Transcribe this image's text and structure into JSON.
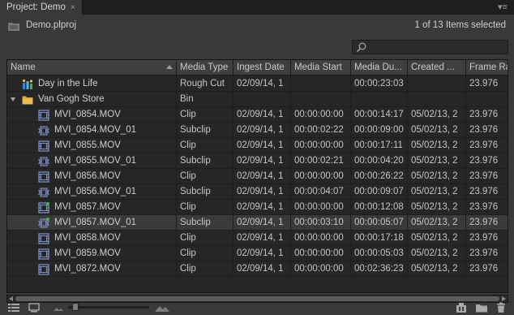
{
  "panel": {
    "tab_label": "Project: Demo",
    "close_glyph": "×",
    "menu_glyph": "▾≡"
  },
  "project": {
    "file_name": "Demo.plproj",
    "selection_status": "1 of 13 Items selected"
  },
  "search": {
    "placeholder": ""
  },
  "columns": [
    "Name",
    "Media Type",
    "Ingest Date",
    "Media Start",
    "Media Du...",
    "Created ...",
    "Frame Ra"
  ],
  "rows": [
    {
      "name": "Day in the Life",
      "icon": "rough-cut-icon",
      "indent": 1,
      "media_type": "Rough Cut",
      "ingest_date": "02/09/14, 1",
      "media_start": "",
      "media_duration": "00:00:23:03",
      "created": "",
      "frame_rate": "23.976"
    },
    {
      "name": "Van Gogh Store",
      "icon": "folder-icon",
      "indent": 0,
      "expanded": true,
      "media_type": "Bin",
      "ingest_date": "",
      "media_start": "",
      "media_duration": "",
      "created": "",
      "frame_rate": ""
    },
    {
      "name": "MVI_0854.MOV",
      "icon": "clip-icon",
      "indent": 2,
      "media_type": "Clip",
      "ingest_date": "02/09/14, 1",
      "media_start": "00:00:00:00",
      "media_duration": "00:00:14:17",
      "created": "05/02/13, 2",
      "frame_rate": "23.976"
    },
    {
      "name": "MVI_0854.MOV_01",
      "icon": "subclip-icon",
      "indent": 2,
      "media_type": "Subclip",
      "ingest_date": "02/09/14, 1",
      "media_start": "00:00:02:22",
      "media_duration": "00:00:09:00",
      "created": "05/02/13, 2",
      "frame_rate": "23.976"
    },
    {
      "name": "MVI_0855.MOV",
      "icon": "clip-icon",
      "indent": 2,
      "media_type": "Clip",
      "ingest_date": "02/09/14, 1",
      "media_start": "00:00:00:00",
      "media_duration": "00:00:17:11",
      "created": "05/02/13, 2",
      "frame_rate": "23.976"
    },
    {
      "name": "MVI_0855.MOV_01",
      "icon": "subclip-icon",
      "indent": 2,
      "media_type": "Subclip",
      "ingest_date": "02/09/14, 1",
      "media_start": "00:00:02:21",
      "media_duration": "00:00:04:20",
      "created": "05/02/13, 2",
      "frame_rate": "23.976"
    },
    {
      "name": "MVI_0856.MOV",
      "icon": "clip-icon",
      "indent": 2,
      "media_type": "Clip",
      "ingest_date": "02/09/14, 1",
      "media_start": "00:00:00:00",
      "media_duration": "00:00:26:22",
      "created": "05/02/13, 2",
      "frame_rate": "23.976"
    },
    {
      "name": "MVI_0856.MOV_01",
      "icon": "subclip-icon",
      "indent": 2,
      "media_type": "Subclip",
      "ingest_date": "02/09/14, 1",
      "media_start": "00:00:04:07",
      "media_duration": "00:00:09:07",
      "created": "05/02/13, 2",
      "frame_rate": "23.976"
    },
    {
      "name": "MVI_0857.MOV",
      "icon": "clip-used-icon",
      "indent": 2,
      "media_type": "Clip",
      "ingest_date": "02/09/14, 1",
      "media_start": "00:00:00:00",
      "media_duration": "00:00:12:08",
      "created": "05/02/13, 2",
      "frame_rate": "23.976"
    },
    {
      "name": "MVI_0857.MOV_01",
      "icon": "subclip-used-icon",
      "indent": 2,
      "selected": true,
      "media_type": "Subclip",
      "ingest_date": "02/09/14, 1",
      "media_start": "00:00:03:10",
      "media_duration": "00:00:05:07",
      "created": "05/02/13, 2",
      "frame_rate": "23.976"
    },
    {
      "name": "MVI_0858.MOV",
      "icon": "clip-icon",
      "indent": 2,
      "media_type": "Clip",
      "ingest_date": "02/09/14, 1",
      "media_start": "00:00:00:00",
      "media_duration": "00:00:17:18",
      "created": "05/02/13, 2",
      "frame_rate": "23.976"
    },
    {
      "name": "MVI_0859.MOV",
      "icon": "clip-icon",
      "indent": 2,
      "media_type": "Clip",
      "ingest_date": "02/09/14, 1",
      "media_start": "00:00:00:00",
      "media_duration": "00:00:05:03",
      "created": "05/02/13, 2",
      "frame_rate": "23.976"
    },
    {
      "name": "MVI_0872.MOV",
      "icon": "clip-icon",
      "indent": 2,
      "media_type": "Clip",
      "ingest_date": "02/09/14, 1",
      "media_start": "00:00:00:00",
      "media_duration": "00:02:36:23",
      "created": "05/02/13, 2",
      "frame_rate": "23.976"
    }
  ],
  "toolbar": {
    "left_icons": [
      "list-view-icon",
      "icon-view-icon"
    ],
    "zoom_min_icon": "zoom-out-mountain-icon",
    "zoom_max_icon": "zoom-in-mountain-icon",
    "right_icons": [
      "new-bin-icon",
      "folder-icon",
      "trash-icon"
    ]
  },
  "colors": {
    "panel_bg": "#393939",
    "table_bg": "#262626",
    "text": "#c6c6c6",
    "folder": "#d6a742",
    "clip_icon": "#7e8fc4",
    "used_badge": "#3fb84f"
  }
}
